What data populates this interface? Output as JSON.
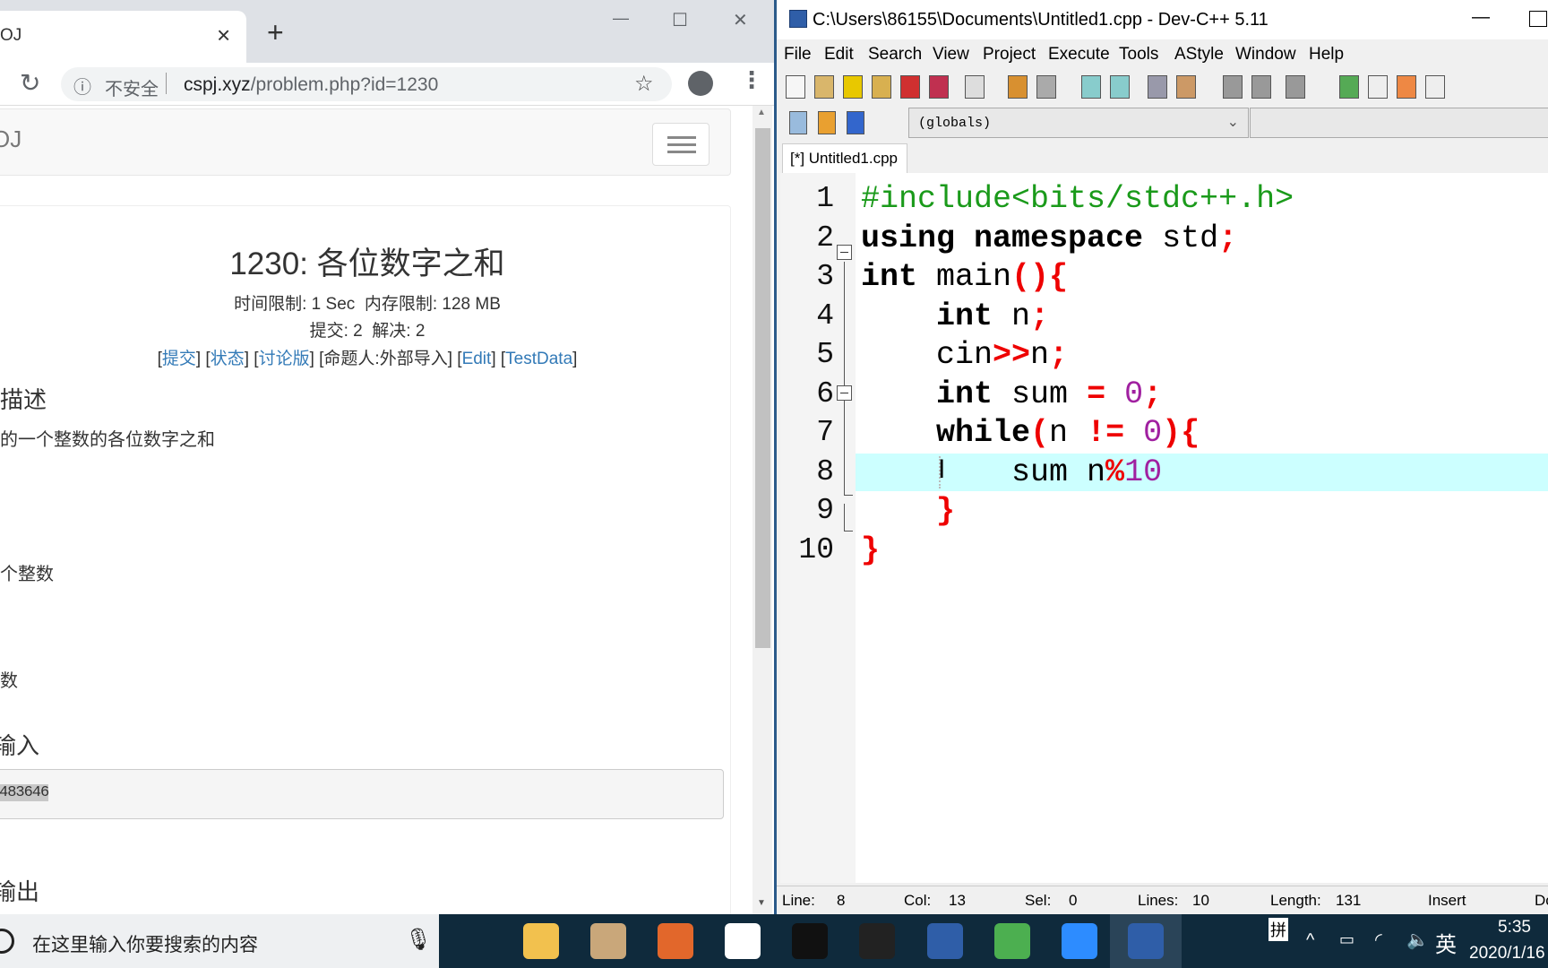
{
  "browser": {
    "tab_title": "OJ",
    "tab_close": "×",
    "new_tab": "+",
    "win_min": "—",
    "win_max": "☐",
    "win_close": "✕",
    "security_label": "不安全",
    "url_host": "cspj.xyz",
    "url_path": "/problem.php?id=1230",
    "site_brand": "OJ",
    "problem": {
      "title": "1230: 各位数字之和",
      "limits": "时间限制: 1 Sec  内存限制: 128 MB",
      "stats": "提交: 2  解决: 2",
      "links": [
        "提交",
        "状态",
        "讨论版"
      ],
      "author": "[命题人:外部导入]",
      "edit": "Edit",
      "testdata": "TestData",
      "desc_heading": "描述",
      "desc_text": "的一个整数的各位数字之和",
      "input_text": "个整数",
      "output_text": "数",
      "sample_input_heading": "输入",
      "sample_input": "483646",
      "sample_output_heading": "输出"
    }
  },
  "devcpp": {
    "title": "C:\\Users\\86155\\Documents\\Untitled1.cpp - Dev-C++ 5.11",
    "menu": [
      "File",
      "Edit",
      "Search",
      "View",
      "Project",
      "Execute",
      "Tools",
      "AStyle",
      "Window",
      "Help"
    ],
    "scope": "(globals)",
    "file_tab": "[*] Untitled1.cpp",
    "code": [
      [
        [
          "#include<bits/stdc++.h>",
          "pp"
        ]
      ],
      [
        [
          "using namespace",
          "kw"
        ],
        [
          " std",
          "id"
        ],
        [
          ";",
          "sym"
        ]
      ],
      [
        [
          "int",
          "kw"
        ],
        [
          " main",
          "id"
        ],
        [
          "(){",
          "sym"
        ]
      ],
      [
        [
          "    int",
          "kw"
        ],
        [
          " n",
          "id"
        ],
        [
          ";",
          "sym"
        ]
      ],
      [
        [
          "    cin",
          "id"
        ],
        [
          ">>",
          "sym"
        ],
        [
          "n",
          "id"
        ],
        [
          ";",
          "sym"
        ]
      ],
      [
        [
          "    int",
          "kw"
        ],
        [
          " sum ",
          "id"
        ],
        [
          "=",
          "sym"
        ],
        [
          " ",
          "id"
        ],
        [
          "0",
          "num"
        ],
        [
          ";",
          "sym"
        ]
      ],
      [
        [
          "    while",
          "kw"
        ],
        [
          "(",
          "sym"
        ],
        [
          "n ",
          "id"
        ],
        [
          "!=",
          "sym"
        ],
        [
          " ",
          "id"
        ],
        [
          "0",
          "num"
        ],
        [
          "){",
          "sym"
        ]
      ],
      [
        [
          "        sum n",
          "id"
        ],
        [
          "%",
          "sym"
        ],
        [
          "10",
          "num"
        ]
      ],
      [
        [
          "    }",
          "sym"
        ]
      ],
      [
        [
          "}",
          "sym"
        ]
      ]
    ],
    "current_line": 8,
    "status": {
      "line_label": "Line:",
      "line": "8",
      "col_label": "Col:",
      "col": "13",
      "sel_label": "Sel:",
      "sel": "0",
      "lines_label": "Lines:",
      "lines": "10",
      "length_label": "Length:",
      "length": "131",
      "mode": "Insert",
      "extra": "Do"
    }
  },
  "taskbar": {
    "search_placeholder": "在这里输入你要搜索的内容",
    "apps": [
      {
        "icon": "task-view-icon",
        "color": "#0f2a3c"
      },
      {
        "icon": "file-explorer-icon",
        "color": "#f2c14e"
      },
      {
        "icon": "paint-icon",
        "color": "#c9a77a"
      },
      {
        "icon": "screen-capture-icon",
        "color": "#e2672b"
      },
      {
        "icon": "baidu-netdisk-icon",
        "color": "#ffffff"
      },
      {
        "icon": "terminal-icon",
        "color": "#111111"
      },
      {
        "icon": "qq-icon",
        "color": "#222222"
      },
      {
        "icon": "devcpp-icon",
        "color": "#2f5ea8"
      },
      {
        "icon": "chrome-icon",
        "color": "#4caf50"
      },
      {
        "icon": "zoom-icon",
        "color": "#2d8cff"
      },
      {
        "icon": "devcpp-active-icon",
        "color": "#2f5ea8"
      }
    ],
    "ime": "拼",
    "lang": "英",
    "time": "5:35",
    "date": "2020/1/16"
  }
}
